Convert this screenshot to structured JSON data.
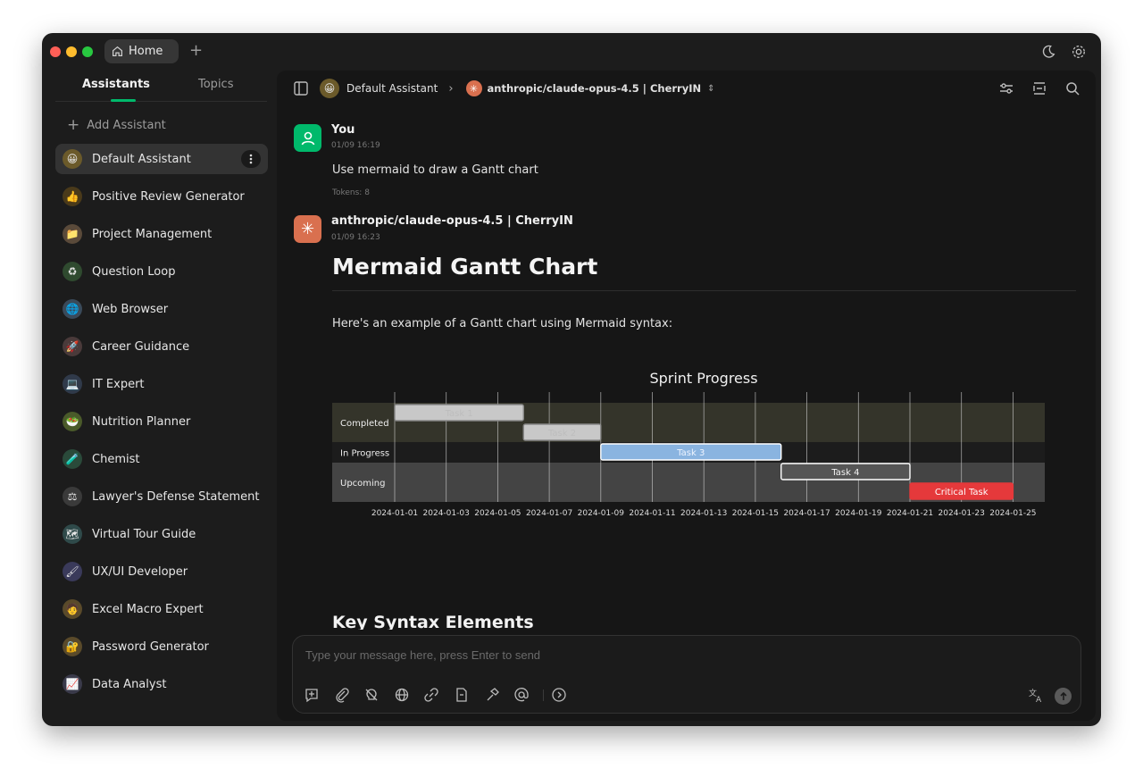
{
  "titlebar": {
    "tab_home": "Home"
  },
  "sidebar": {
    "tabs": [
      "Assistants",
      "Topics"
    ],
    "add_label": "Add Assistant",
    "items": [
      {
        "label": "Default Assistant",
        "icon": "😀"
      },
      {
        "label": "Positive Review Generator",
        "icon": "👍"
      },
      {
        "label": "Project Management",
        "icon": "📁"
      },
      {
        "label": "Question Loop",
        "icon": "♻"
      },
      {
        "label": "Web Browser",
        "icon": "🌐"
      },
      {
        "label": "Career Guidance",
        "icon": "🚀"
      },
      {
        "label": "IT Expert",
        "icon": "💻"
      },
      {
        "label": "Nutrition Planner",
        "icon": "🥗"
      },
      {
        "label": "Chemist",
        "icon": "🧪"
      },
      {
        "label": "Lawyer's Defense Statement",
        "icon": "⚖"
      },
      {
        "label": "Virtual Tour Guide",
        "icon": "🗺"
      },
      {
        "label": "UX/UI Developer",
        "icon": "🖌"
      },
      {
        "label": "Excel Macro Expert",
        "icon": "🧑"
      },
      {
        "label": "Password Generator",
        "icon": "🔐"
      },
      {
        "label": "Data Analyst",
        "icon": "📈"
      }
    ]
  },
  "topbar": {
    "assistant": "Default Assistant",
    "model": "anthropic/claude-opus-4.5 | CherryIN"
  },
  "messages": {
    "user": {
      "name": "You",
      "time": "01/09 16:19",
      "text": "Use mermaid to draw a Gantt chart",
      "tokens": "Tokens: 8"
    },
    "assistant": {
      "name": "anthropic/claude-opus-4.5 | CherryIN",
      "time": "01/09 16:23",
      "heading": "Mermaid Gantt Chart",
      "intro": "Here's an example of a Gantt chart using Mermaid syntax:",
      "heading2": "Key Syntax Elements"
    }
  },
  "chart_data": {
    "type": "gantt",
    "title": "Sprint Progress",
    "sections": [
      "Completed",
      "In Progress",
      "Upcoming"
    ],
    "tasks": [
      {
        "name": "Task 1",
        "section": "Completed",
        "start": "2024-01-01",
        "end": "2024-01-06",
        "status": "done"
      },
      {
        "name": "Task 2",
        "section": "Completed",
        "start": "2024-01-06",
        "end": "2024-01-09",
        "status": "done"
      },
      {
        "name": "Task 3",
        "section": "In Progress",
        "start": "2024-01-09",
        "end": "2024-01-16",
        "status": "active"
      },
      {
        "name": "Task 4",
        "section": "Upcoming",
        "start": "2024-01-16",
        "end": "2024-01-21",
        "status": "future"
      },
      {
        "name": "Critical Task",
        "section": "Upcoming",
        "start": "2024-01-21",
        "end": "2024-01-25",
        "status": "critical"
      }
    ],
    "x_ticks": [
      "2024-01-01",
      "2024-01-03",
      "2024-01-05",
      "2024-01-07",
      "2024-01-09",
      "2024-01-11",
      "2024-01-13",
      "2024-01-15",
      "2024-01-17",
      "2024-01-19",
      "2024-01-21",
      "2024-01-23",
      "2024-01-25"
    ],
    "grid": true
  },
  "input": {
    "placeholder": "Type your message here, press Enter to send"
  },
  "colors": {
    "accent": "#00b96b",
    "critical": "#e5393b",
    "active": "#8ab4e0",
    "done": "#c8c8c8",
    "future": "#555555"
  }
}
